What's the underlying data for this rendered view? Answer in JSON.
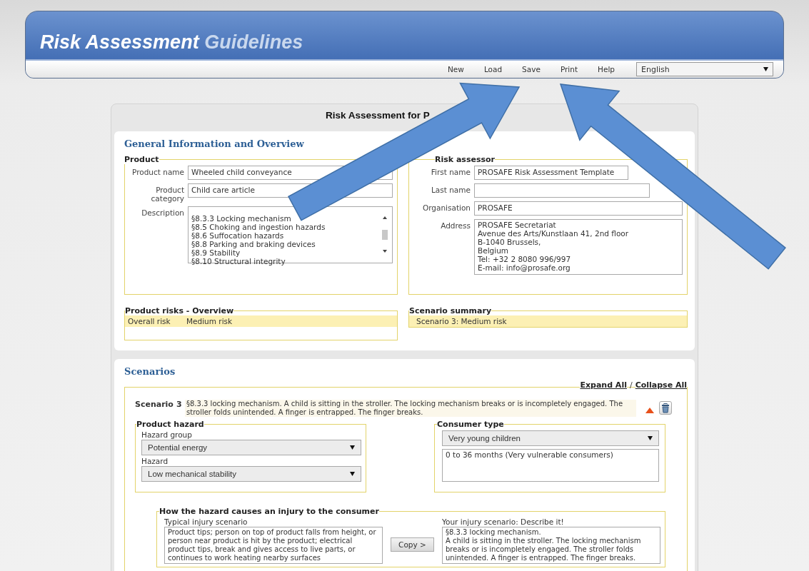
{
  "header": {
    "title": "Risk Assessment",
    "title_accent": "Guidelines",
    "menu": [
      "New",
      "Load",
      "Save",
      "Print",
      "Help"
    ],
    "language": "English"
  },
  "page_title": "Risk Assessment for P",
  "general": {
    "heading": "General Information and Overview",
    "product": {
      "legend": "Product",
      "fields": [
        {
          "label": "Product name",
          "kind": "input",
          "value": "Wheeled child conveyance"
        },
        {
          "label": "Product category",
          "kind": "input",
          "value": "Child care article"
        },
        {
          "label": "Description",
          "kind": "list",
          "lines": [
            "§8.3.3 Locking mechanism",
            "§8.5 Choking and ingestion hazards",
            "§8.6 Suffocation hazards",
            "§8.8 Parking and braking devices",
            "§8.9 Stability",
            "§8.10 Structural integrity"
          ]
        }
      ]
    },
    "assessor": {
      "legend": "Risk assessor",
      "fields": [
        {
          "label": "First name",
          "kind": "input",
          "value": "PROSAFE Risk Assessment Template"
        },
        {
          "label": "Last name",
          "kind": "input"
        },
        {
          "label": "Organisation",
          "kind": "input",
          "value": "PROSAFE"
        },
        {
          "label": "Address",
          "kind": "textarea",
          "lines": [
            "PROSAFE Secretariat",
            "Avenue des Arts/Kunstlaan 41, 2nd floor",
            "B-1040 Brussels,",
            "Belgium",
            "Tel: +32 2 8080 996/997",
            "E-mail: info@prosafe.org"
          ]
        }
      ]
    },
    "risks_overview": {
      "legend": "Product risks - Overview",
      "label": "Overall risk",
      "value": "Medium risk"
    },
    "scenario_summary": {
      "legend": "Scenario summary",
      "items": [
        "Scenario 3: Medium risk"
      ]
    }
  },
  "scenarios": {
    "heading": "Scenarios",
    "expand_all": "Expand All",
    "separator": "/",
    "collapse_all": "Collapse All",
    "items": [
      {
        "label": "Scenario",
        "number": "3",
        "description": "§8.3.3 locking mechanism. A child is sitting in the stroller. The locking mechanism breaks or is incompletely engaged. The stroller folds unintended. A finger is entrapped. The finger breaks.",
        "expanded": true,
        "hazard": {
          "legend": "Product hazard",
          "group_label": "Hazard group",
          "group": "Potential energy",
          "hazard_label": "Hazard",
          "hazard": "Low mechanical stability"
        },
        "consumer": {
          "legend": "Consumer type",
          "type": "Very young children",
          "details": "0 to 36 months (Very vulnerable consumers)"
        },
        "injury": {
          "legend": "How the hazard causes an injury to the consumer",
          "typical_label": "Typical injury scenario",
          "typical": "Product tips; person on top of product falls from height, or person near product is hit by the product; electrical product tips, break and gives access to live parts, or continues to work heating nearby surfaces",
          "copy_button": "Copy >",
          "yours_label": "Your injury scenario: Describe it!",
          "yours": "§8.3.3 locking mechanism.\nA child is sitting in the stroller. The locking mechanism breaks or is incompletely engaged. The stroller folds unintended. A finger is entrapped. The finger breaks."
        }
      }
    ]
  }
}
